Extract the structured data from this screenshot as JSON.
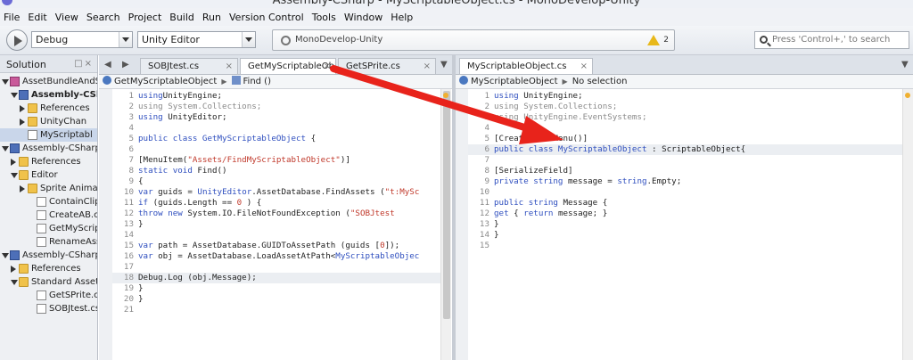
{
  "window": {
    "title": "Assembly-CSharp - MyScriptableObject.cs - MonoDevelop-Unity"
  },
  "menu": [
    "File",
    "Edit",
    "View",
    "Search",
    "Project",
    "Build",
    "Run",
    "Version Control",
    "Tools",
    "Window",
    "Help"
  ],
  "toolbar": {
    "config": "Debug",
    "target": "Unity Editor",
    "status_text": "MonoDevelop-Unity",
    "warning_count": "2",
    "search_placeholder": "Press 'Control+,' to search"
  },
  "solution": {
    "title": "Solution",
    "items": [
      {
        "label": "AssetBundleAndSprit",
        "kind": "sol",
        "depth": 0,
        "expand": "open"
      },
      {
        "label": "Assembly-CSharp",
        "kind": "proj",
        "depth": 1,
        "expand": "open",
        "bold": true
      },
      {
        "label": "References",
        "kind": "folder",
        "depth": 2,
        "expand": "closed"
      },
      {
        "label": "UnityChan",
        "kind": "folder",
        "depth": 2,
        "expand": "closed"
      },
      {
        "label": "MyScriptabl",
        "kind": "file",
        "depth": 2,
        "expand": "",
        "selected": true
      },
      {
        "label": "Assembly-CSharp-",
        "kind": "proj",
        "depth": 0,
        "expand": "open"
      },
      {
        "label": "References",
        "kind": "folder",
        "depth": 1,
        "expand": "closed"
      },
      {
        "label": "Editor",
        "kind": "folder",
        "depth": 1,
        "expand": "open"
      },
      {
        "label": "Sprite Animati",
        "kind": "folder",
        "depth": 2,
        "expand": "closed"
      },
      {
        "label": "ContainClip.cs",
        "kind": "file",
        "depth": 3,
        "expand": ""
      },
      {
        "label": "CreateAB.cs",
        "kind": "file",
        "depth": 3,
        "expand": ""
      },
      {
        "label": "GetMyScriptab",
        "kind": "file",
        "depth": 3,
        "expand": ""
      },
      {
        "label": "RenameAssets",
        "kind": "file",
        "depth": 3,
        "expand": ""
      },
      {
        "label": "Assembly-CSharp-",
        "kind": "proj",
        "depth": 0,
        "expand": "open"
      },
      {
        "label": "References",
        "kind": "folder",
        "depth": 1,
        "expand": "closed"
      },
      {
        "label": "Standard Assets",
        "kind": "folder",
        "depth": 1,
        "expand": "open"
      },
      {
        "label": "GetSPrite.cs",
        "kind": "file",
        "depth": 3,
        "expand": ""
      },
      {
        "label": "SOBJtest.cs",
        "kind": "file",
        "depth": 3,
        "expand": ""
      }
    ]
  },
  "left_editor": {
    "tabs": [
      {
        "label": "SOBJtest.cs",
        "active": false
      },
      {
        "label": "GetMyScriptableObje",
        "active": true
      },
      {
        "label": "GetSPrite.cs",
        "active": false
      }
    ],
    "path": [
      "GetMyScriptableObject",
      "Find ()"
    ],
    "highlight_line": "18",
    "lines": [
      {
        "n": "1",
        "t": [
          [
            "kw",
            "using"
          ],
          [
            "",
            "UnityEngine;"
          ]
        ]
      },
      {
        "n": "2",
        "t": [
          [
            "cm",
            "using System.Collections;"
          ]
        ]
      },
      {
        "n": "3",
        "t": [
          [
            "kw",
            "using"
          ],
          [
            "",
            " UnityEditor;"
          ]
        ]
      },
      {
        "n": "4",
        "t": []
      },
      {
        "n": "5",
        "t": [
          [
            "kw",
            "public class "
          ],
          [
            "ty",
            "GetMyScriptableObject"
          ],
          [
            "",
            "  {"
          ]
        ]
      },
      {
        "n": "6",
        "t": []
      },
      {
        "n": "7",
        "t": [
          [
            "",
            "    [MenuItem("
          ],
          [
            "str",
            "\"Assets/FindMyScriptableObject\""
          ],
          [
            "",
            ")]"
          ]
        ]
      },
      {
        "n": "8",
        "t": [
          [
            "kw",
            "    static void"
          ],
          [
            "",
            " Find()"
          ]
        ]
      },
      {
        "n": "9",
        "t": [
          [
            "",
            "    {"
          ]
        ]
      },
      {
        "n": "10",
        "t": [
          [
            "kw",
            "        var"
          ],
          [
            "",
            " guids = "
          ],
          [
            "ty",
            "UnityEditor"
          ],
          [
            "",
            ".AssetDatabase.FindAssets ("
          ],
          [
            "str",
            "\"t:MySc"
          ]
        ]
      },
      {
        "n": "11",
        "t": [
          [
            "kw",
            "        if"
          ],
          [
            "",
            " (guids.Length == "
          ],
          [
            "str",
            "0"
          ],
          [
            "",
            " ) {"
          ]
        ]
      },
      {
        "n": "12",
        "t": [
          [
            "kw",
            "            throw new"
          ],
          [
            "",
            " System.IO.FileNotFoundException ("
          ],
          [
            "str",
            "\"SOBJtest"
          ]
        ]
      },
      {
        "n": "13",
        "t": [
          [
            "",
            "        }"
          ]
        ]
      },
      {
        "n": "14",
        "t": []
      },
      {
        "n": "15",
        "t": [
          [
            "kw",
            "        var"
          ],
          [
            "",
            " path = AssetDatabase.GUIDToAssetPath (guids ["
          ],
          [
            "str",
            "0"
          ],
          [
            "",
            "]);"
          ]
        ]
      },
      {
        "n": "16",
        "t": [
          [
            "kw",
            "        var"
          ],
          [
            "",
            " obj = AssetDatabase.LoadAssetAtPath<"
          ],
          [
            "ty",
            "MyScriptableObjec"
          ]
        ]
      },
      {
        "n": "17",
        "t": []
      },
      {
        "n": "18",
        "t": [
          [
            "",
            "        Debug.Log (obj.Message);"
          ]
        ]
      },
      {
        "n": "19",
        "t": [
          [
            "",
            "    }"
          ]
        ]
      },
      {
        "n": "20",
        "t": [
          [
            "",
            "}"
          ]
        ]
      },
      {
        "n": "21",
        "t": []
      }
    ]
  },
  "right_editor": {
    "tabs": [
      {
        "label": "MyScriptableObject.cs",
        "active": true
      }
    ],
    "path": [
      "MyScriptableObject",
      "No selection"
    ],
    "highlight_line": "6",
    "lines": [
      {
        "n": "1",
        "t": [
          [
            "kw",
            "using"
          ],
          [
            "",
            " UnityEngine;"
          ]
        ]
      },
      {
        "n": "2",
        "t": [
          [
            "cm",
            "using System.Collections;"
          ]
        ]
      },
      {
        "n": "3",
        "t": [
          [
            "cm",
            "using UnityEngine.EventSystems;"
          ]
        ]
      },
      {
        "n": "4",
        "t": []
      },
      {
        "n": "5",
        "t": [
          [
            "",
            "[CreateAssetMenu()]"
          ]
        ]
      },
      {
        "n": "6",
        "t": [
          [
            "kw",
            "public class "
          ],
          [
            "ty",
            "MyScriptableObject"
          ],
          [
            "",
            " : ScriptableObject{"
          ]
        ]
      },
      {
        "n": "7",
        "t": []
      },
      {
        "n": "8",
        "t": [
          [
            "",
            "    [SerializeField]"
          ]
        ]
      },
      {
        "n": "9",
        "t": [
          [
            "kw",
            "    private string"
          ],
          [
            "",
            " message = "
          ],
          [
            "kw",
            "string"
          ],
          [
            "",
            ".Empty;"
          ]
        ]
      },
      {
        "n": "10",
        "t": []
      },
      {
        "n": "11",
        "t": [
          [
            "kw",
            "    public string"
          ],
          [
            "",
            " Message {"
          ]
        ]
      },
      {
        "n": "12",
        "t": [
          [
            "kw",
            "        get"
          ],
          [
            "",
            " { "
          ],
          [
            "kw",
            "return"
          ],
          [
            "",
            " message; }"
          ]
        ]
      },
      {
        "n": "13",
        "t": [
          [
            "",
            "    }"
          ]
        ]
      },
      {
        "n": "14",
        "t": [
          [
            "",
            "}"
          ]
        ]
      },
      {
        "n": "15",
        "t": []
      }
    ]
  },
  "colors": {
    "annotation_arrow": "#e8231b",
    "keyword": "#2f4fbf",
    "string": "#c0392b",
    "comment": "#8a8a8a"
  }
}
